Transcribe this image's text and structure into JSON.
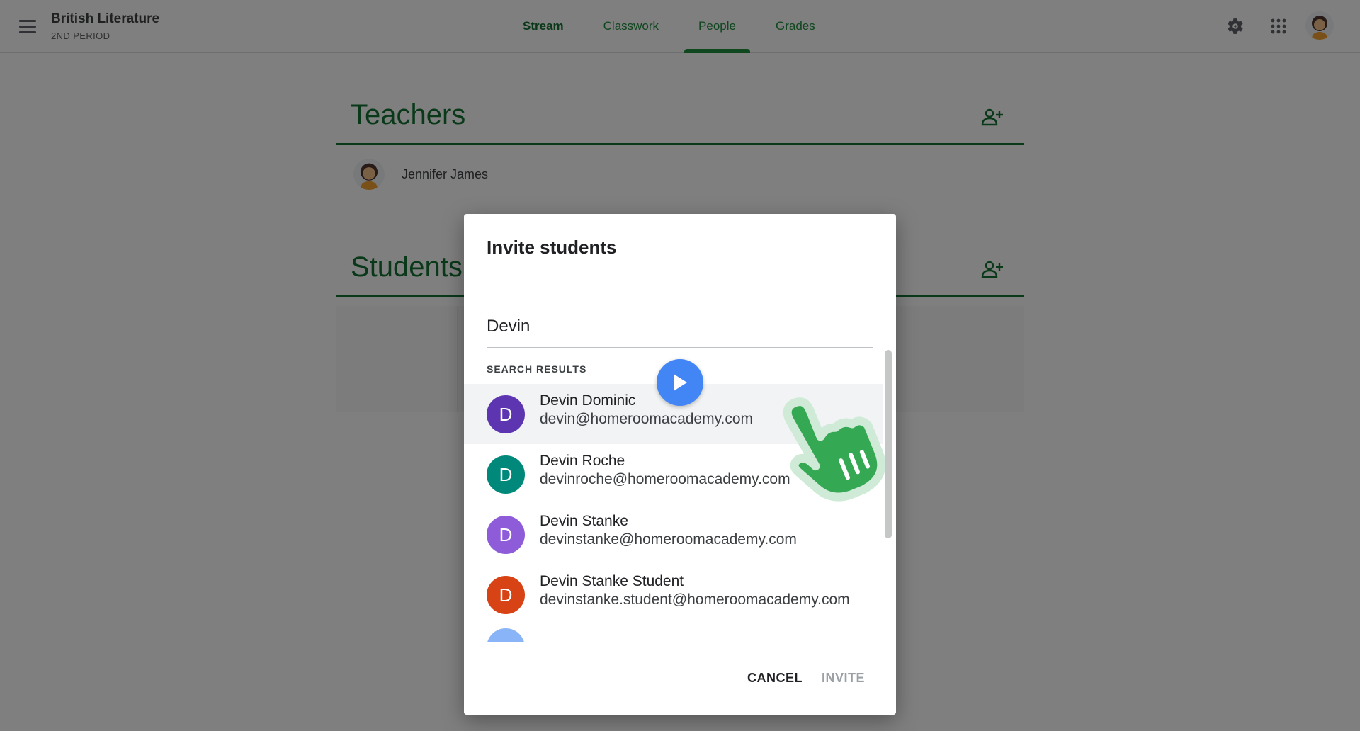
{
  "header": {
    "class_title": "British Literature",
    "class_subtitle": "2ND PERIOD",
    "tabs": [
      {
        "label": "Stream"
      },
      {
        "label": "Classwork"
      },
      {
        "label": "People"
      },
      {
        "label": "Grades"
      }
    ],
    "active_tab": "People",
    "icons": [
      "menu-icon",
      "gear-icon",
      "apps-grid-icon",
      "user-avatar"
    ]
  },
  "teachers": {
    "heading": "Teachers",
    "list": [
      {
        "name": "Jennifer James"
      }
    ]
  },
  "students": {
    "heading": "Students"
  },
  "dialog": {
    "title": "Invite students",
    "search_value": "Devin",
    "results_label": "SEARCH RESULTS",
    "results": [
      {
        "initial": "D",
        "name": "Devin Dominic",
        "email": "devin@homeroomacademy.com",
        "color": "#5e35b1"
      },
      {
        "initial": "D",
        "name": "Devin Roche",
        "email": "devinroche@homeroomacademy.com",
        "color": "#00897b"
      },
      {
        "initial": "D",
        "name": "Devin Stanke",
        "email": "devinstanke@homeroomacademy.com",
        "color": "#8e5cd9"
      },
      {
        "initial": "D",
        "name": "Devin Stanke Student",
        "email": "devinstanke.student@homeroomacademy.com",
        "color": "#d84315"
      }
    ],
    "cancel_label": "CANCEL",
    "invite_label": "INVITE"
  },
  "colors": {
    "accent_green": "#137333",
    "play_blue": "#4285f4",
    "hand_green": "#34a853"
  }
}
